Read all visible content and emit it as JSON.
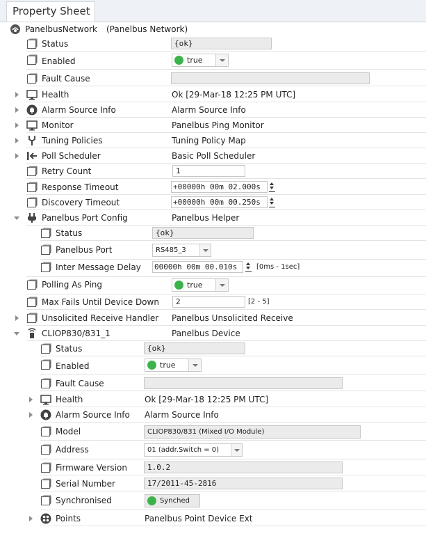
{
  "tab": {
    "label": "Property Sheet"
  },
  "root": {
    "name": "PanelbusNetwork",
    "type": "(Panelbus Network)"
  },
  "status_value": "{ok}",
  "enabled_value": "true",
  "health_value": "Ok [29-Mar-18 12:25 PM UTC]",
  "retry_count_value": "1",
  "response_timeout_value": "+00000h 00m 02.000s",
  "discovery_timeout_value": "+00000h 00m 00.250s",
  "labels": {
    "status": "Status",
    "enabled": "Enabled",
    "fault_cause": "Fault Cause",
    "health": "Health",
    "alarm_source_info": "Alarm Source Info",
    "monitor": "Monitor",
    "tuning_policies": "Tuning Policies",
    "poll_scheduler": "Poll Scheduler",
    "retry_count": "Retry Count",
    "response_timeout": "Response Timeout",
    "discovery_timeout": "Discovery Timeout",
    "port_config": "Panelbus Port Config",
    "panelbus_port": "Panelbus Port",
    "inter_message_delay": "Inter Message Delay",
    "polling_as_ping": "Polling As Ping",
    "max_fails": "Max Fails Until Device Down",
    "unsolicited": "Unsolicited Receive Handler",
    "device": "CLIOP830/831_1",
    "model": "Model",
    "address": "Address",
    "firmware_version": "Firmware Version",
    "serial_number": "Serial Number",
    "synchronised": "Synchronised",
    "points": "Points"
  },
  "values": {
    "alarm_source_info": "Alarm Source Info",
    "monitor": "Panelbus Ping Monitor",
    "tuning_policies": "Tuning Policy Map",
    "poll_scheduler": "Basic Poll Scheduler",
    "port_config": "Panelbus Helper",
    "panelbus_port": "RS485_3",
    "inter_message_delay": "00000h 00m 00.010s",
    "inter_message_delay_range": "[0ms - 1sec]",
    "max_fails": "2",
    "max_fails_range": "[2 - 5]",
    "unsolicited": "Panelbus Unsolicited Receive",
    "device": "Panelbus Device",
    "model": "CLIOP830/831 (Mixed I/O Module)",
    "address": "01 (addr.Switch = 0)",
    "firmware_version": "1.0.2",
    "serial_number": "17/2011-45-2816",
    "synchronised": "Synched",
    "points": "Panelbus Point Device Ext"
  },
  "colors": {
    "ok_green": "#3cb34a",
    "readonly_field": "#ebebeb"
  }
}
